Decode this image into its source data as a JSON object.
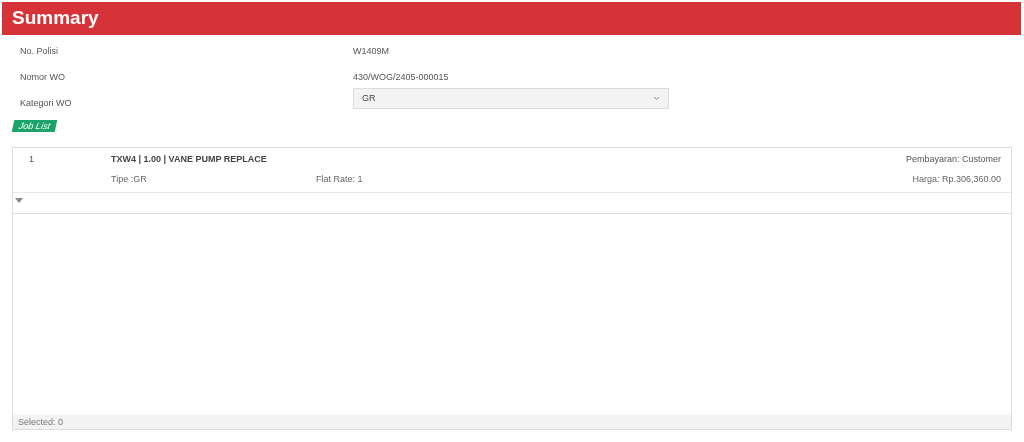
{
  "header": {
    "title": "Summary"
  },
  "fields": [
    {
      "kind": "text",
      "label": "No. Polisi",
      "value": "W1409M"
    },
    {
      "kind": "text",
      "label": "Nomor WO",
      "value": "430/WOG/2405-000015"
    },
    {
      "kind": "select",
      "label": "Kategori WO",
      "value": "GR"
    }
  ],
  "job_list": {
    "tag": "Job List",
    "rows": [
      {
        "number": "1",
        "title": "TXW4 | 1.00 | VANE PUMP REPLACE",
        "type": "Tipe :GR",
        "flat_rate": "Flat Rate: 1",
        "payment": "Pembayaran: Customer",
        "price": "Harga: Rp.306,360.00"
      }
    ],
    "footer": "Selected: 0"
  }
}
